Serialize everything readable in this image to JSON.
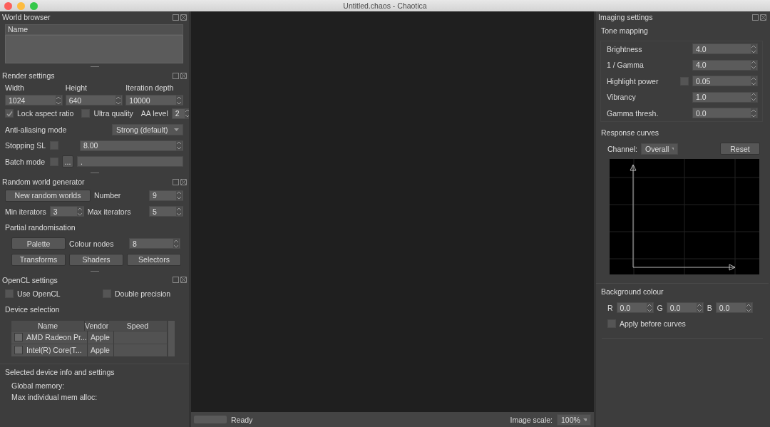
{
  "window": {
    "title": "Untitled.chaos - Chaotica"
  },
  "world_browser": {
    "title": "World browser",
    "column": "Name"
  },
  "render_settings": {
    "title": "Render settings",
    "sizes": [
      {
        "label": "Width",
        "value": "1024"
      },
      {
        "label": "Height",
        "value": "640"
      },
      {
        "label": "Iteration depth",
        "value": "10000"
      }
    ],
    "lock_aspect_ratio": {
      "label": "Lock aspect ratio",
      "checked": true
    },
    "ultra_quality": {
      "label": "Ultra quality",
      "checked": false
    },
    "aa_level": {
      "label": "AA level",
      "value": "2"
    },
    "aa_mode": {
      "label": "Anti-aliasing mode",
      "value": "Strong (default)"
    },
    "stopping_sl": {
      "label": "Stopping SL",
      "checked": false,
      "value": "8.00"
    },
    "batch_mode": {
      "label": "Batch mode",
      "checked": false,
      "button": "...",
      "value": "."
    }
  },
  "random_world_generator": {
    "title": "Random world generator",
    "button": "New random worlds",
    "number": {
      "label": "Number",
      "value": "9"
    },
    "min_iterators": {
      "label": "Min iterators",
      "value": "3"
    },
    "max_iterators": {
      "label": "Max iterators",
      "value": "5"
    },
    "partial_title": "Partial randomisation",
    "palette_button": "Palette",
    "colour_nodes": {
      "label": "Colour nodes",
      "value": "8"
    },
    "buttons": [
      "Transforms",
      "Shaders",
      "Selectors"
    ]
  },
  "opencl_settings": {
    "title": "OpenCL settings",
    "use_opencl": {
      "label": "Use OpenCL",
      "checked": false
    },
    "double_precision": {
      "label": "Double precision",
      "checked": false
    },
    "device_selection": "Device selection",
    "columns": [
      "Name",
      "Vendor",
      "Speed"
    ],
    "rows": [
      {
        "checked": false,
        "name": "AMD Radeon Pr...",
        "vendor": "Apple"
      },
      {
        "checked": false,
        "name": "Intel(R) Core(T...",
        "vendor": "Apple"
      }
    ],
    "info_title": "Selected device info and settings",
    "info": [
      "Global memory:",
      "Max individual mem alloc:"
    ]
  },
  "status_bar": {
    "status": "Ready",
    "level": 0,
    "scale_label": "Image scale:",
    "scale": "100%"
  },
  "imaging_settings": {
    "title": "Imaging settings",
    "tone_title": "Tone mapping",
    "tone": [
      {
        "label": "Brightness",
        "value": "4.0"
      },
      {
        "label": "1 / Gamma",
        "value": "4.0"
      },
      {
        "label": "Highlight power",
        "value": "0.05",
        "checked": false
      },
      {
        "label": "Vibrancy",
        "value": "1.0"
      },
      {
        "label": "Gamma thresh.",
        "value": "0.0"
      }
    ],
    "curves_title": "Response curves",
    "channel_label": "Channel:",
    "channel": "Overall",
    "reset": "Reset",
    "background_title": "Background colour",
    "rgb": [
      {
        "label": "R",
        "value": "0.0"
      },
      {
        "label": "G",
        "value": "0.0"
      },
      {
        "label": "B",
        "value": "0.0"
      }
    ],
    "apply_before_curves": {
      "label": "Apply before curves",
      "checked": false
    }
  }
}
